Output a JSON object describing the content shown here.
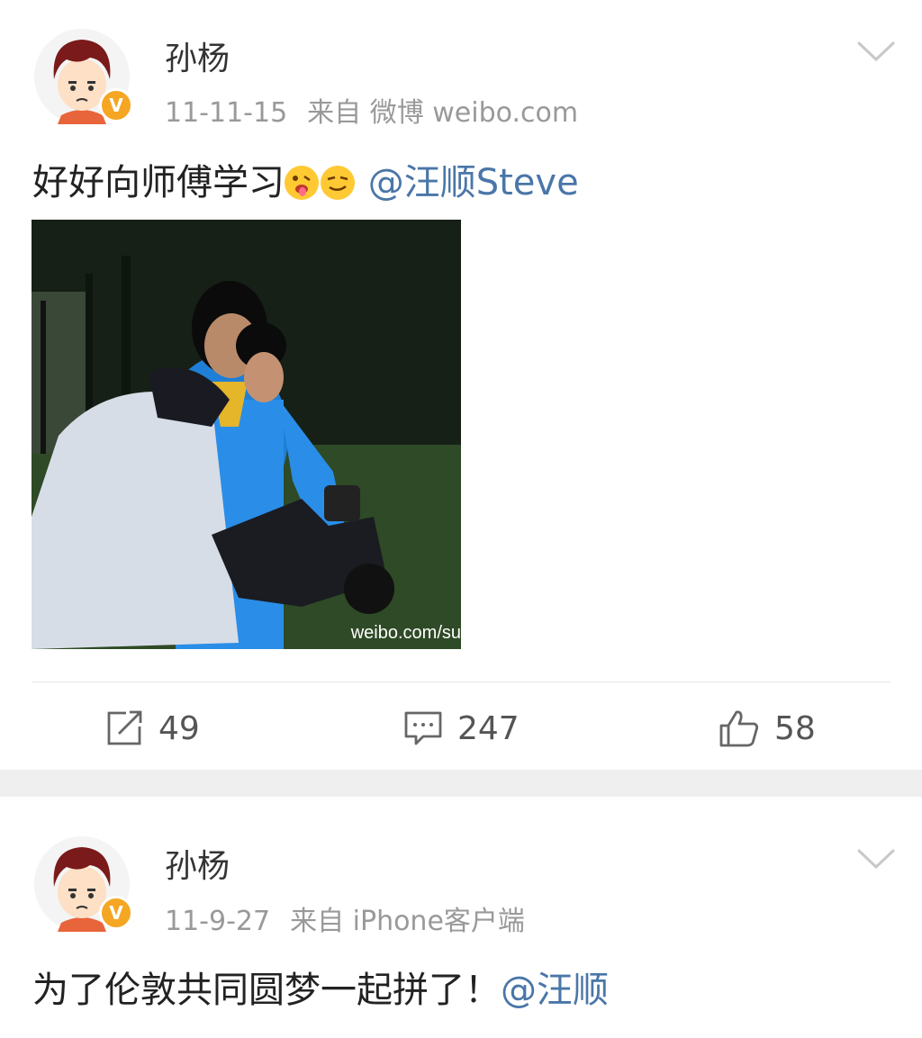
{
  "posts": [
    {
      "author": "孙杨",
      "date": "11-11-15",
      "source_prefix": "来自",
      "source": "微博 weibo.com",
      "text": "好好向师傅学习",
      "mention": "@汪顺Steve",
      "image_watermark": "weibo.com/su",
      "reposts": "49",
      "comments": "247",
      "likes": "58"
    },
    {
      "author": "孙杨",
      "date": "11-9-27",
      "source_prefix": "来自",
      "source": "iPhone客户端",
      "text": "为了伦敦共同圆梦一起拼了！",
      "mention": "@汪顺"
    }
  ],
  "badge_label": "V",
  "icons": [
    "chevron-down-icon",
    "verified-badge-icon",
    "tongue-emoji-icon",
    "smirk-emoji-icon",
    "repost-icon",
    "comment-icon",
    "like-icon"
  ],
  "colors": {
    "mention": "#4a76a8",
    "badge": "#f5a623",
    "meta": "#999999",
    "separator": "#efefef"
  }
}
